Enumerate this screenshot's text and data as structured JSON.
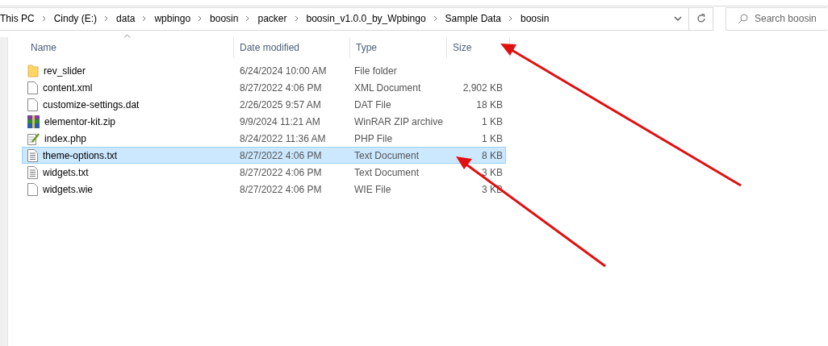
{
  "breadcrumb": [
    "This PC",
    "Cindy (E:)",
    "data",
    "wpbingo",
    "boosin",
    "packer",
    "boosin_v1.0.0_by_Wpbingo",
    "Sample Data",
    "boosin"
  ],
  "search": {
    "placeholder": "Search boosin"
  },
  "columns": [
    "Name",
    "Date modified",
    "Type",
    "Size"
  ],
  "files": [
    {
      "kind": "folder",
      "name": "rev_slider",
      "date": "6/24/2024 10:00 AM",
      "type": "File folder",
      "selected": false
    },
    {
      "kind": "blank",
      "name": "content.xml",
      "date": "8/27/2022 4:06 PM",
      "type": "XML Document",
      "size": "2,902 KB",
      "selected": false
    },
    {
      "kind": "blank",
      "name": "customize-settings.dat",
      "date": "2/26/2025 9:57 AM",
      "type": "DAT File",
      "size": "18 KB",
      "selected": false
    },
    {
      "kind": "archive",
      "name": "elementor-kit.zip",
      "date": "9/9/2024 11:21 AM",
      "type": "WinRAR ZIP archive",
      "size": "1 KB",
      "selected": false
    },
    {
      "kind": "script",
      "name": "index.php",
      "date": "8/24/2022 11:36 AM",
      "type": "PHP File",
      "size": "1 KB",
      "selected": false
    },
    {
      "kind": "text",
      "name": "theme-options.txt",
      "date": "8/27/2022 4:06 PM",
      "type": "Text Document",
      "size": "8 KB",
      "selected": true
    },
    {
      "kind": "text",
      "name": "widgets.txt",
      "date": "8/27/2022 4:06 PM",
      "type": "Text Document",
      "size": "3 KB",
      "selected": false
    },
    {
      "kind": "blank",
      "name": "widgets.wie",
      "date": "8/27/2022 4:06 PM",
      "type": "WIE File",
      "size": "3 KB",
      "selected": false
    }
  ]
}
